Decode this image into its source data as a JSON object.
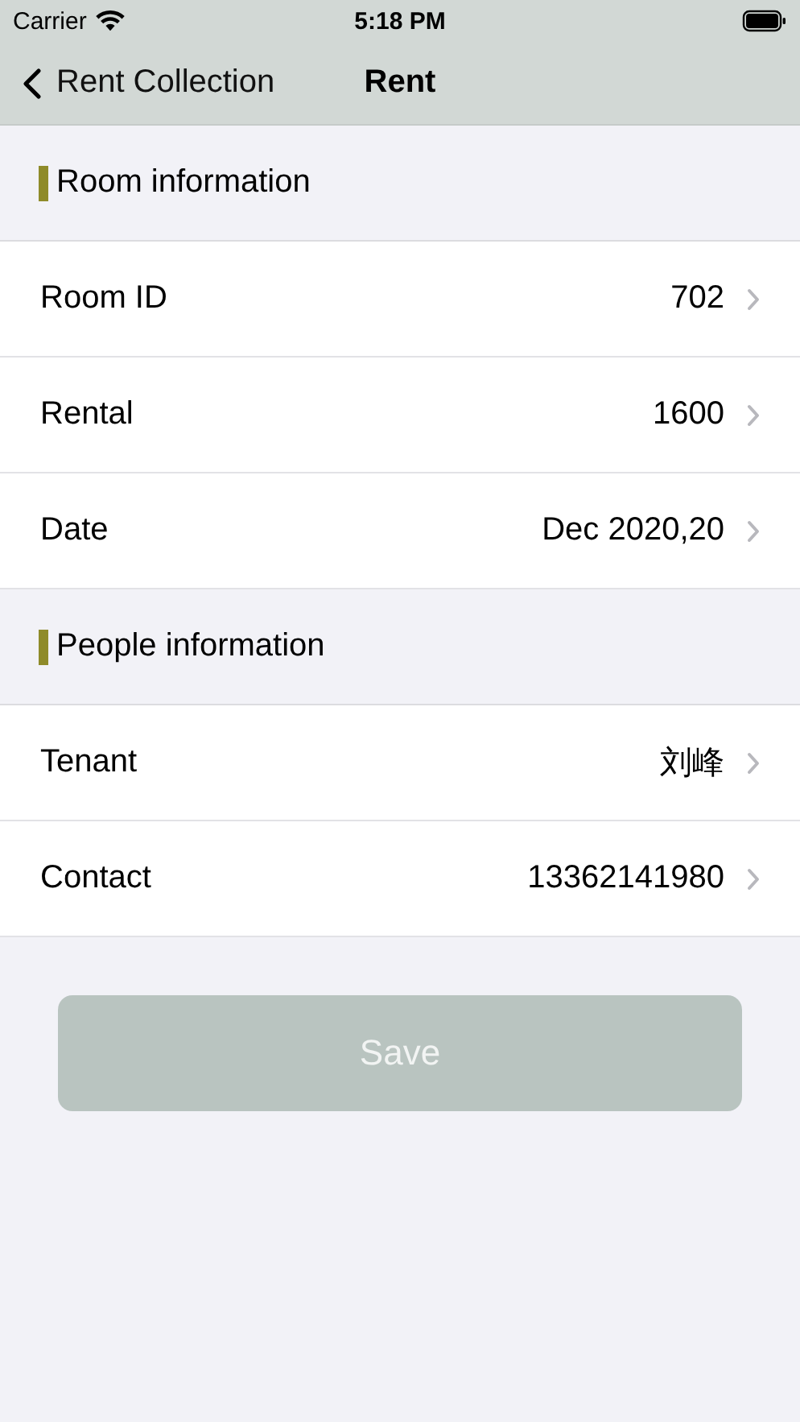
{
  "status_bar": {
    "carrier": "Carrier",
    "time": "5:18 PM"
  },
  "nav": {
    "back": "Rent Collection",
    "title": "Rent"
  },
  "sections": [
    {
      "title": "Room information",
      "rows": [
        {
          "label": "Room ID",
          "value": "702"
        },
        {
          "label": "Rental",
          "value": "1600"
        },
        {
          "label": "Date",
          "value": "Dec 2020,20"
        }
      ]
    },
    {
      "title": "People information",
      "rows": [
        {
          "label": "Tenant",
          "value": "刘峰"
        },
        {
          "label": "Contact",
          "value": "13362141980"
        }
      ]
    }
  ],
  "save_button": {
    "label": "Save"
  }
}
